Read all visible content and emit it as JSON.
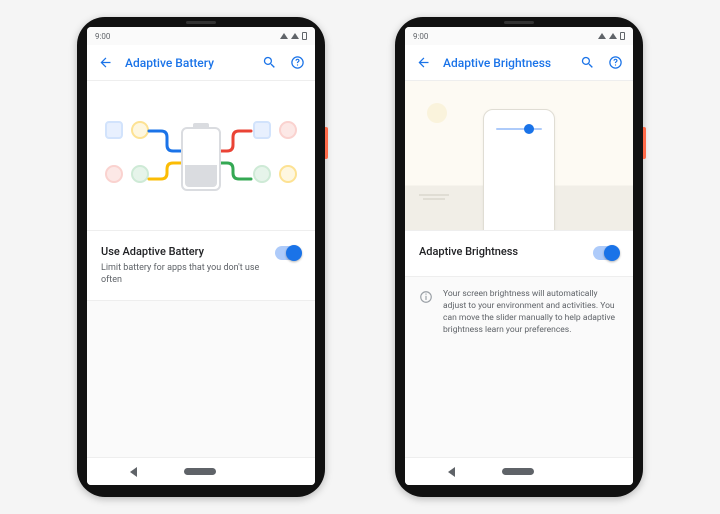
{
  "status_time": "9:00",
  "left": {
    "title": "Adaptive Battery",
    "card": {
      "title": "Use Adaptive Battery",
      "subtitle": "Limit battery for apps that you don't use often"
    }
  },
  "right": {
    "title": "Adaptive Brightness",
    "card": {
      "title": "Adaptive Brightness"
    },
    "info": "Your screen brightness will automatically adjust to your environment and activities. You can move the slider manually to help adaptive brightness learn your preferences."
  },
  "colors": {
    "blue": "#1a73e8",
    "red": "#ea4335",
    "yellow": "#fbbc04",
    "green": "#34a853"
  }
}
